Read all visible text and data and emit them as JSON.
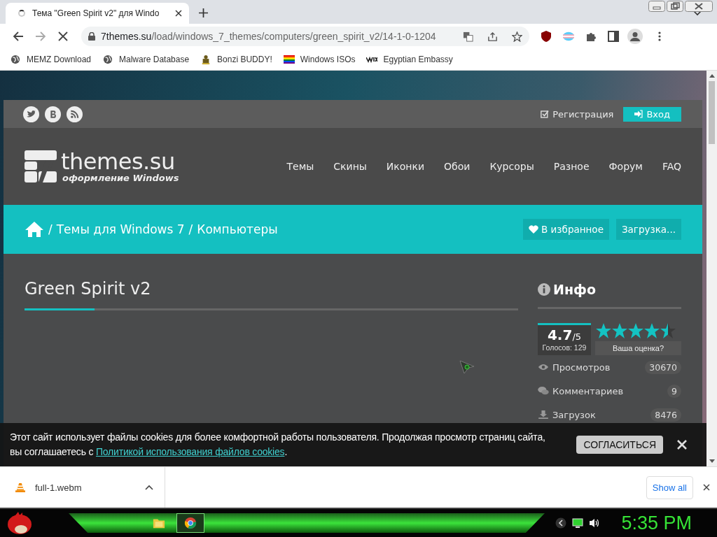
{
  "tab": {
    "title": "Тема \"Green Spirit v2\" для Windo",
    "loading": true
  },
  "address": {
    "host": "7themes.su",
    "path": "/load/windows_7_themes/computers/green_spirit_v2/14-1-0-1204"
  },
  "bookmarks": [
    {
      "label": "MEMZ Download",
      "kind": "globe"
    },
    {
      "label": "Malware Database",
      "kind": "globe"
    },
    {
      "label": "Bonzi BUDDY!",
      "kind": "figure"
    },
    {
      "label": "Windows ISOs",
      "kind": "rainbow"
    },
    {
      "label": "Egyptian Embassy",
      "kind": "wix"
    }
  ],
  "site": {
    "register": "Регистрация",
    "login": "Вход",
    "logo_title": "themes.su",
    "logo_tagline": "оформление Windows",
    "nav": [
      "Темы",
      "Скины",
      "Иконки",
      "Обои",
      "Курсоры",
      "Разное",
      "Форум",
      "FAQ"
    ],
    "breadcrumb": {
      "separator": "/",
      "items": [
        "Темы для Windows 7",
        "Компьютеры"
      ]
    },
    "favorite": "В избранное",
    "download": "Загрузка...",
    "title": "Green Spirit v2",
    "info": {
      "heading": "Инфо",
      "rating": "4.7",
      "scale": "/5",
      "votes": "Голосов: 129",
      "stars": 4.5,
      "rate_prompt": "Ваша оценка?",
      "stats": [
        {
          "kind": "views",
          "label": "Просмотров",
          "value": "30670"
        },
        {
          "kind": "comments",
          "label": "Комментариев",
          "value": "9"
        },
        {
          "kind": "downloads",
          "label": "Загрузок",
          "value": "8476"
        }
      ]
    }
  },
  "cookie": {
    "line_1": "Этот сайт использует файлы cookies для более комфортной работы пользователя. Продолжая просмотр страниц сайта,",
    "line_2": "вы соглашаетесь с ",
    "link": "Политикой использования файлов cookies",
    "after": ".",
    "accept": "СОГЛАСИТЬСЯ"
  },
  "download_bar": {
    "file": "full-1.webm",
    "show_all": "Show all"
  },
  "taskbar": {
    "clock": "5:35 PM"
  }
}
